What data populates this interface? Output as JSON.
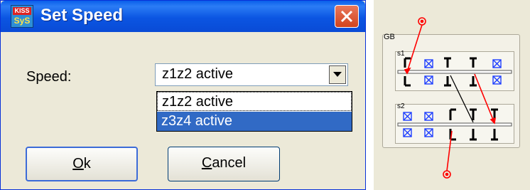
{
  "dialog": {
    "title": "Set Speed",
    "app_icon": {
      "top": "KISS",
      "bottom": "SyS"
    },
    "speed_label": "Speed:",
    "speed_select": {
      "value": "z1z2 active"
    },
    "dropdown_options": [
      "z1z2 active",
      "z3z4 active"
    ],
    "highlighted_option": "z3z4 active",
    "buttons": {
      "ok_prefix": "O",
      "ok_rest": "k",
      "cancel_prefix": "C",
      "cancel_rest": "ancel"
    },
    "colors": {
      "titlebar": "#0b55e2",
      "close": "#d1431d",
      "selection": "#316ac5",
      "face": "#ece9d8"
    }
  },
  "schematic": {
    "group_label": "GB",
    "shaft_labels": [
      "s1",
      "s2"
    ],
    "colors": {
      "shaft": "#000000",
      "gear": "#000000",
      "inactive_gear": "#1f3fff",
      "power_flow": "#ff0000"
    }
  }
}
